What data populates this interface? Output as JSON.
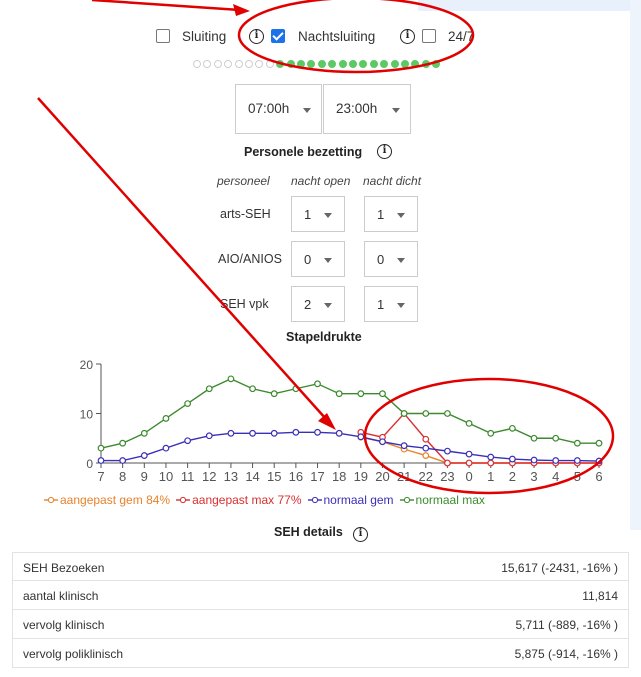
{
  "closures": {
    "sluiting_label": "Sluiting",
    "sluiting_checked": false,
    "nachtsluiting_label": "Nachtsluiting",
    "nachtsluiting_checked": true,
    "always_open_label": "24/7",
    "always_open_checked": false,
    "info_glyph": "i"
  },
  "hour_dots": {
    "states": [
      false,
      false,
      false,
      false,
      false,
      false,
      false,
      false,
      true,
      true,
      true,
      true,
      true,
      true,
      true,
      true,
      true,
      true,
      true,
      true,
      true,
      true,
      true,
      true
    ],
    "on_color": "#5cc964",
    "off_color": "#cfcfcf"
  },
  "hours": {
    "open": "07:00h",
    "close": "23:00h"
  },
  "staffing": {
    "title": "Personele bezetting",
    "col_role": "personeel",
    "col_night_open": "nacht open",
    "col_night_closed": "nacht dicht",
    "rows": [
      {
        "role": "arts-SEH",
        "night_open": "1",
        "night_closed": "1"
      },
      {
        "role": "AIO/ANIOS",
        "night_open": "0",
        "night_closed": "0"
      },
      {
        "role": "SEH vpk",
        "night_open": "2",
        "night_closed": "1"
      }
    ]
  },
  "chart_title": "Stapeldrukte",
  "chart_data": {
    "type": "line",
    "title": "Stapeldrukte",
    "categories": [
      "7",
      "8",
      "9",
      "10",
      "11",
      "12",
      "13",
      "14",
      "15",
      "16",
      "17",
      "18",
      "19",
      "20",
      "21",
      "22",
      "23",
      "0",
      "1",
      "2",
      "3",
      "4",
      "5",
      "6"
    ],
    "ylim": [
      0,
      20
    ],
    "yticks": [
      0,
      10,
      20
    ],
    "grid": false,
    "legend": "bottom",
    "series": [
      {
        "name": "aangepast gem 84%",
        "color": "#e8822b",
        "values": [
          null,
          null,
          null,
          null,
          null,
          null,
          null,
          null,
          null,
          null,
          null,
          null,
          5.2,
          4.3,
          2.8,
          1.5,
          0,
          0,
          0,
          0,
          0,
          0,
          0,
          0
        ]
      },
      {
        "name": "aangepast max 77%",
        "color": "#d93030",
        "values": [
          null,
          null,
          null,
          null,
          null,
          null,
          null,
          null,
          null,
          null,
          null,
          null,
          6.2,
          5.2,
          10,
          4.8,
          0,
          0,
          0,
          0,
          0,
          0,
          0,
          0
        ]
      },
      {
        "name": "normaal gem",
        "color": "#3a2fb8",
        "values": [
          0.5,
          0.5,
          1.5,
          3,
          4.5,
          5.5,
          6,
          6,
          6,
          6.2,
          6.2,
          6,
          5.3,
          4.3,
          3.5,
          3,
          2.4,
          1.8,
          1.2,
          0.8,
          0.6,
          0.5,
          0.5,
          0.4
        ]
      },
      {
        "name": "normaal max",
        "color": "#3c8a2e",
        "values": [
          3,
          4,
          6,
          9,
          12,
          15,
          17,
          15,
          14,
          15,
          16,
          14,
          14,
          14,
          10,
          10,
          10,
          8,
          6,
          7,
          5,
          5,
          4,
          4
        ]
      }
    ]
  },
  "seh_details": {
    "title": "SEH details",
    "rows": [
      {
        "label": "SEH Bezoeken",
        "value": "15,617 (-2431, -16% )"
      },
      {
        "label": "aantal klinisch",
        "value": "11,814"
      },
      {
        "label": "vervolg klinisch",
        "value": "5,711 (-889, -16% )"
      },
      {
        "label": "vervolg poliklinisch",
        "value": "5,875 (-914, -16% )"
      }
    ]
  },
  "annotation_color": "#e00000"
}
